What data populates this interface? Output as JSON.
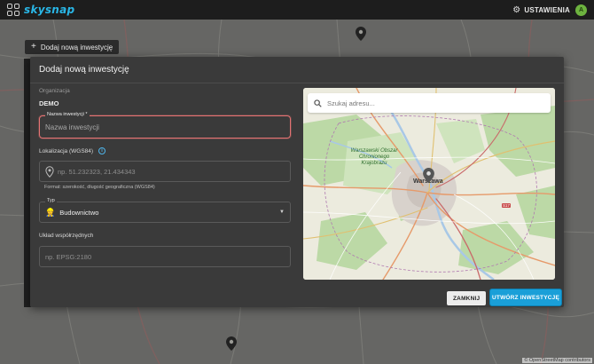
{
  "app": {
    "logo_text": "skysnap",
    "settings_label": "USTAWIENIA",
    "avatar_initial": "A",
    "brand_color": "#1a9fd8"
  },
  "background": {
    "add_button_label": "Dodaj nową inwestycję",
    "attribution": "© OpenStreetMap contributors"
  },
  "dialog": {
    "title": "Dodaj nową inwestycję",
    "organization": {
      "label": "Organizacja",
      "value": "DEMO"
    },
    "name_field": {
      "label": "Nazwa inwestycji *",
      "placeholder": "Nazwa inwestycji",
      "value": "",
      "error_color": "#e57373"
    },
    "location": {
      "label": "Lokalizacja (WGS84)",
      "placeholder": "np. 51.232323, 21.434343",
      "value": "",
      "hint": "Format: szerokość, długość geograficzna (WGS84)",
      "info_icon": "info-icon"
    },
    "type_field": {
      "label": "Typ",
      "selected": "Budownictwo",
      "icon": "worker-icon"
    },
    "coord_system": {
      "label": "Układ współrzędnych",
      "placeholder": "np. EPSG:2180",
      "value": ""
    },
    "map": {
      "search_placeholder": "Szukaj adresu...",
      "labels": {
        "park": "Warszawski Obszar Chronionego Krajobrazu",
        "city": "Warszawa",
        "road": "S17"
      }
    },
    "buttons": {
      "close": "ZAMKNIJ",
      "create": "UTWÓRZ INWESTYCJĘ"
    }
  }
}
